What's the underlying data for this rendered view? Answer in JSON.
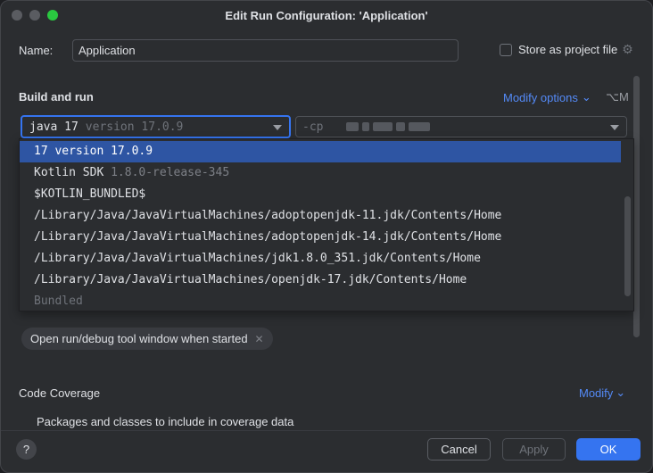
{
  "window": {
    "title": "Edit Run Configuration: 'Application'"
  },
  "name": {
    "label": "Name:",
    "value": "Application"
  },
  "store_as_project_file": {
    "label": "Store as project file",
    "checked": false
  },
  "build_and_run": {
    "title": "Build and run",
    "modify_options_label": "Modify options",
    "modify_options_shortcut": "⌥M",
    "jdk_select": {
      "value": "java 17",
      "version": "version 17.0.9"
    },
    "classpath": {
      "prefix": "-cp"
    }
  },
  "jdk_dropdown": {
    "items": [
      {
        "label": "17 version 17.0.9",
        "dim": "",
        "selected": true
      },
      {
        "label": "Kotlin SDK ",
        "dim": "1.8.0-release-345",
        "selected": false
      },
      {
        "label": "$KOTLIN_BUNDLED$",
        "dim": "",
        "selected": false
      },
      {
        "label": "/Library/Java/JavaVirtualMachines/adoptopenjdk-11.jdk/Contents/Home",
        "dim": "",
        "selected": false
      },
      {
        "label": "/Library/Java/JavaVirtualMachines/adoptopenjdk-14.jdk/Contents/Home",
        "dim": "",
        "selected": false
      },
      {
        "label": "/Library/Java/JavaVirtualMachines/jdk1.8.0_351.jdk/Contents/Home",
        "dim": "",
        "selected": false
      },
      {
        "label": "/Library/Java/JavaVirtualMachines/openjdk-17.jdk/Contents/Home",
        "dim": "",
        "selected": false
      },
      {
        "label": "Bundled",
        "dim": "",
        "selected": false,
        "muted": true
      }
    ]
  },
  "chip": {
    "label": "Open run/debug tool window when started"
  },
  "code_coverage": {
    "title": "Code Coverage",
    "modify_label": "Modify",
    "packages_label": "Packages and classes to include in coverage data"
  },
  "footer": {
    "help": "?",
    "cancel": "Cancel",
    "apply": "Apply",
    "ok": "OK"
  },
  "colors": {
    "accent": "#3574f0",
    "link": "#548af7",
    "background": "#2b2d30",
    "selection": "#2e55a3"
  }
}
